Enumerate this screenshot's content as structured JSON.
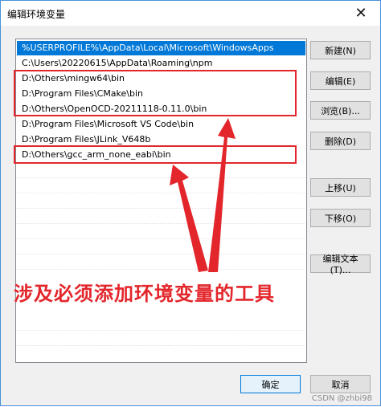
{
  "window": {
    "title": "编辑环境变量",
    "close_glyph": "✕"
  },
  "path_list": [
    "%USERPROFILE%\\AppData\\Local\\Microsoft\\WindowsApps",
    "C:\\Users\\20220615\\AppData\\Roaming\\npm",
    "D:\\Others\\mingw64\\bin",
    "D:\\Program Files\\CMake\\bin",
    "D:\\Others\\OpenOCD-20211118-0.11.0\\bin",
    "D:\\Program Files\\Microsoft VS Code\\bin",
    "D:\\Program Files\\JLink_V648b",
    "D:\\Others\\gcc_arm_none_eabi\\bin"
  ],
  "selected_index": 0,
  "buttons": {
    "new": "新建(N)",
    "edit": "编辑(E)",
    "browse": "浏览(B)...",
    "delete": "删除(D)",
    "move_up": "上移(U)",
    "move_down": "下移(O)",
    "edit_text": "编辑文本(T)...",
    "ok": "确定",
    "cancel": "取消"
  },
  "annotation": {
    "text": "涉及必须添加环境变量的工具",
    "color": "#e3262b"
  },
  "watermark": "CSDN @zhbi98",
  "colors": {
    "selection": "#0078d7",
    "highlight_red": "#e3262b"
  }
}
